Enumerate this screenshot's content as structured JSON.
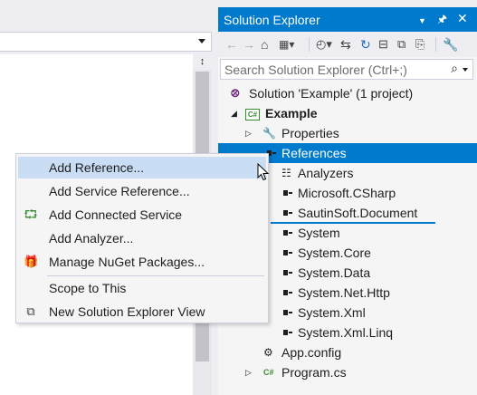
{
  "solution_explorer": {
    "title": "Solution Explorer",
    "title_icons": [
      "dropdown-icon",
      "pin-icon",
      "close-icon"
    ],
    "toolbar": [
      "back-icon",
      "forward-icon",
      "home-icon",
      "switch-views-icon",
      "pending-changes-icon",
      "sync-icon",
      "refresh-icon",
      "collapse-all-icon",
      "show-all-files-icon",
      "properties-icon"
    ],
    "search": {
      "placeholder": "Search Solution Explorer (Ctrl+;)"
    },
    "tree": {
      "solution": "Solution 'Example' (1 project)",
      "project": "Example",
      "properties": "Properties",
      "references": "References",
      "reference_items": [
        "Analyzers",
        "Microsoft.CSharp",
        "SautinSoft.Document",
        "System",
        "System.Core",
        "System.Data",
        "System.Net.Http",
        "System.Xml",
        "System.Xml.Linq"
      ],
      "app_config": "App.config",
      "program": "Program.cs"
    }
  },
  "context_menu": {
    "items": [
      {
        "label": "Add Reference...",
        "icon": ""
      },
      {
        "label": "Add Service Reference...",
        "icon": ""
      },
      {
        "label": "Add Connected Service",
        "icon": "connected-service-icon"
      },
      {
        "label": "Add Analyzer...",
        "icon": ""
      },
      {
        "label": "Manage NuGet Packages...",
        "icon": "nuget-icon"
      },
      {
        "label": "Scope to This",
        "icon": ""
      },
      {
        "label": "New Solution Explorer View",
        "icon": "new-view-icon"
      }
    ]
  },
  "colors": {
    "accent": "#007acc",
    "menu_hover": "#c9def5",
    "background": "#eeeef2"
  }
}
